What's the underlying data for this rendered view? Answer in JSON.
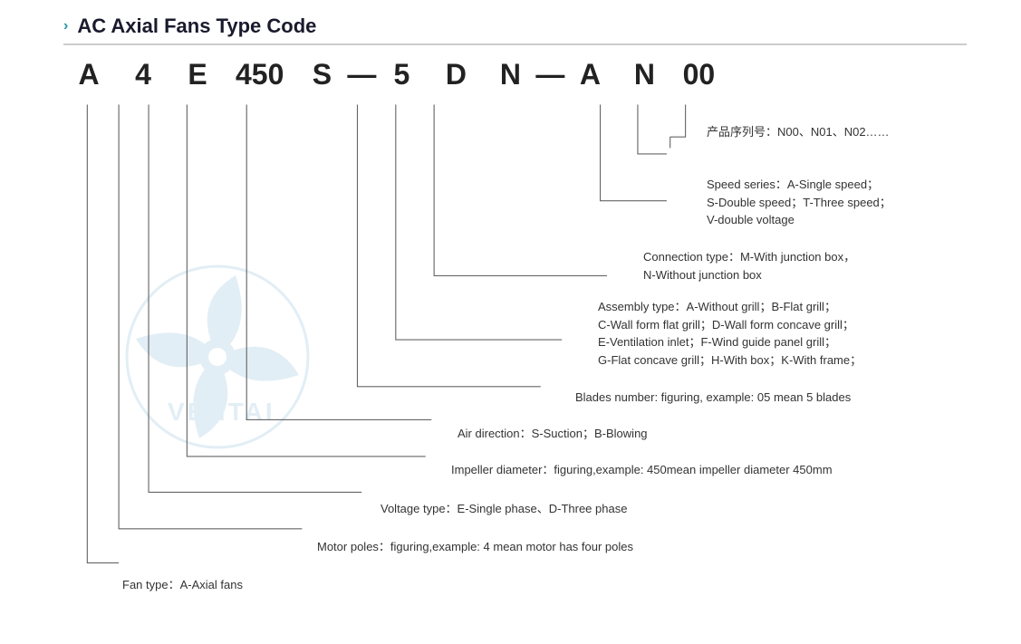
{
  "title": {
    "chevron": "›",
    "text": "AC Axial Fans Type Code"
  },
  "type_code": {
    "letters": [
      "A",
      "4",
      "E",
      "450",
      "S",
      "—",
      "5",
      "D",
      "N",
      "—",
      "A",
      "N",
      "00"
    ]
  },
  "labels": {
    "product_series": {
      "cn": "产品序列号：N00、N01、N02……",
      "line2": ""
    },
    "speed_series": {
      "main": "Speed series：A-Single speed；",
      "line2": "S-Double speed；T-Three speed；",
      "line3": "V-double voltage"
    },
    "connection_type": {
      "main": "Connection type：M-With junction box，",
      "line2": "N-Without junction box"
    },
    "assembly_type": {
      "main": "Assembly type：A-Without grill；B-Flat grill；",
      "line2": "C-Wall form flat grill；D-Wall form concave grill；",
      "line3": "E-Ventilation inlet；F-Wind guide panel grill；",
      "line4": "G-Flat concave grill；H-With box；K-With frame；"
    },
    "blades_number": {
      "main": "Blades number: figuring, example: 05 mean 5 blades"
    },
    "air_direction": {
      "main": "Air direction：S-Suction；B-Blowing"
    },
    "impeller_diameter": {
      "main": "Impeller diameter：figuring,example: 450mean impeller diameter 450mm"
    },
    "voltage_type": {
      "main": "Voltage type：E-Single phase、D-Three phase"
    },
    "motor_poles": {
      "main": "Motor poles：figuring,example: 4 mean motor has four poles"
    },
    "fan_type": {
      "main": "Fan type：A-Axial fans"
    }
  },
  "colors": {
    "accent": "#1a7ab5",
    "line_color": "#555555",
    "title_color": "#1a1a2e"
  }
}
